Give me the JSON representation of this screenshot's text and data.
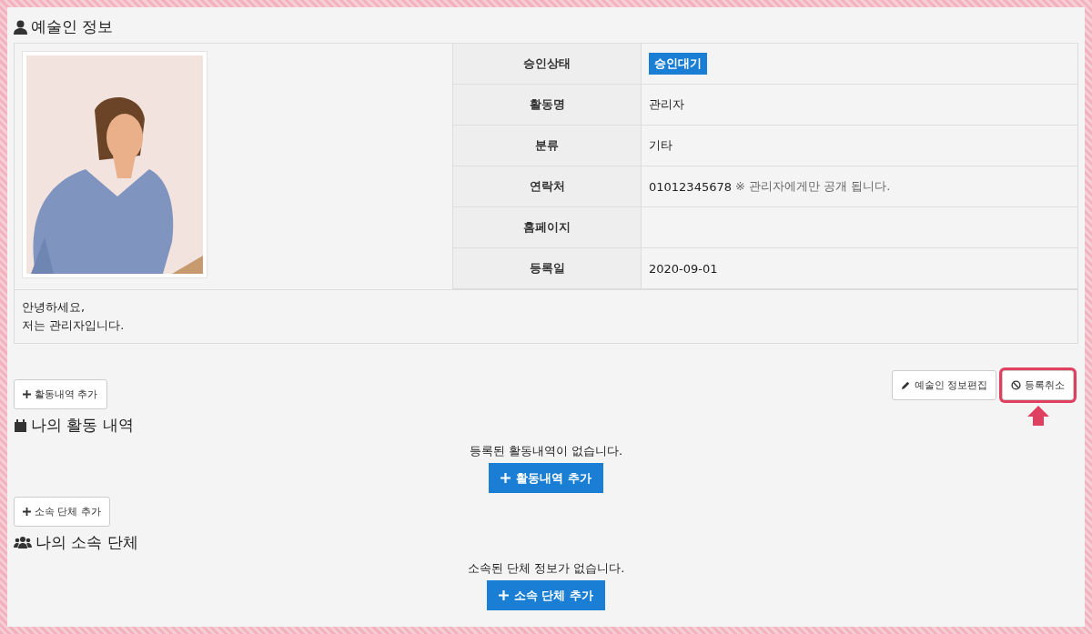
{
  "artist_section": {
    "title": "예술인 정보",
    "rows": [
      {
        "label": "승인상태",
        "kind": "badge",
        "value": "승인대기"
      },
      {
        "label": "활동명",
        "kind": "text",
        "value": "관리자"
      },
      {
        "label": "분류",
        "kind": "text",
        "value": "기타"
      },
      {
        "label": "연락처",
        "kind": "text",
        "value": "01012345678",
        "note": "※ 관리자에게만 공개 됩니다."
      },
      {
        "label": "홈페이지",
        "kind": "text"
      },
      {
        "label": "등록일",
        "kind": "text",
        "value": "2020-09-01"
      }
    ],
    "intro": [
      "안녕하세요,",
      "저는 관리자입니다."
    ],
    "actions": [
      {
        "label": "예술인 정보편집",
        "highlighted": false
      },
      {
        "label": "등록취소",
        "highlighted": true
      }
    ]
  },
  "sections": [
    {
      "add_button": "활동내역 추가",
      "title": "나의 활동 내역",
      "empty_text": "등록된 활동내역이 없습니다.",
      "primary_button": "활동내역 추가"
    },
    {
      "add_button": "소속 단체 추가",
      "title": "나의 소속 단체",
      "empty_text": "소속된 단체 정보가 없습니다.",
      "primary_button": "소속 단체 추가"
    }
  ]
}
